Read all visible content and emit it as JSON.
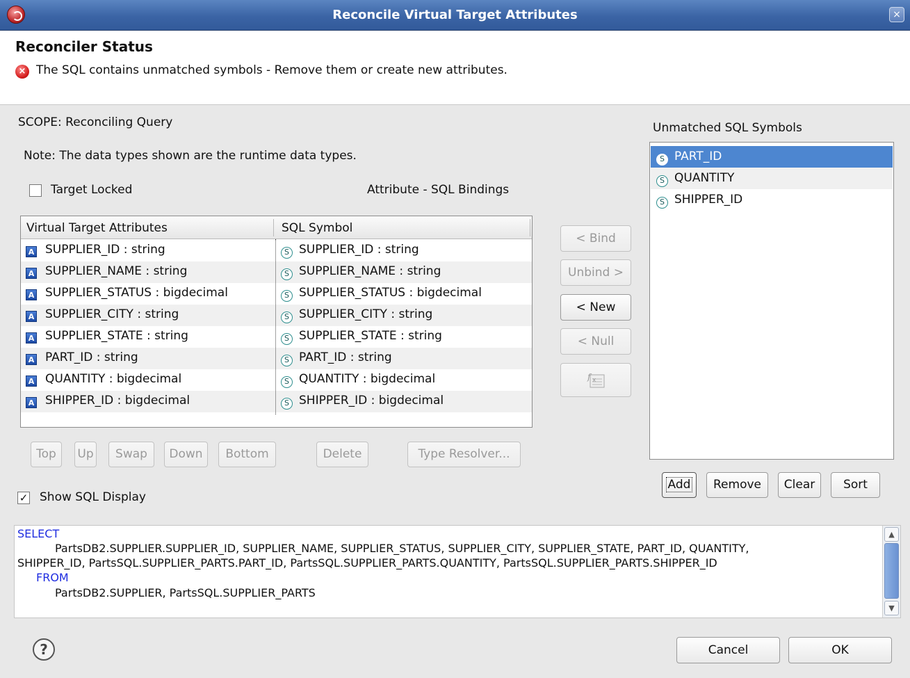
{
  "window": {
    "title": "Reconcile Virtual Target Attributes",
    "close_glyph": "×"
  },
  "status": {
    "title": "Reconciler Status",
    "message": "The SQL contains unmatched symbols - Remove them or create new attributes.",
    "error_glyph": "×"
  },
  "scope_label": "SCOPE: Reconciling Query",
  "note": "Note: The data types shown are the runtime data types.",
  "target_locked": {
    "label": "Target Locked",
    "checked": false
  },
  "bindings_label": "Attribute - SQL Bindings",
  "table": {
    "headers": [
      "Virtual Target Attributes",
      "SQL Symbol"
    ],
    "rows": [
      {
        "attribute": "SUPPLIER_ID : string",
        "symbol": "SUPPLIER_ID : string"
      },
      {
        "attribute": "SUPPLIER_NAME : string",
        "symbol": "SUPPLIER_NAME : string"
      },
      {
        "attribute": "SUPPLIER_STATUS : bigdecimal",
        "symbol": "SUPPLIER_STATUS : bigdecimal"
      },
      {
        "attribute": "SUPPLIER_CITY : string",
        "symbol": "SUPPLIER_CITY : string"
      },
      {
        "attribute": "SUPPLIER_STATE : string",
        "symbol": "SUPPLIER_STATE : string"
      },
      {
        "attribute": "PART_ID : string",
        "symbol": "PART_ID : string"
      },
      {
        "attribute": "QUANTITY : bigdecimal",
        "symbol": "QUANTITY : bigdecimal"
      },
      {
        "attribute": "SHIPPER_ID : bigdecimal",
        "symbol": "SHIPPER_ID : bigdecimal"
      }
    ]
  },
  "icons": {
    "attribute": "A",
    "symbol": "S"
  },
  "middle_buttons": {
    "bind": "< Bind",
    "unbind": "Unbind >",
    "new": "< New",
    "null": "< Null"
  },
  "order_buttons": {
    "top": "Top",
    "up": "Up",
    "swap": "Swap",
    "down": "Down",
    "bottom": "Bottom",
    "delete": "Delete",
    "type_resolver": "Type Resolver..."
  },
  "show_sql": {
    "label": "Show SQL Display",
    "checked": true,
    "check_glyph": "✓"
  },
  "unmatched": {
    "label": "Unmatched SQL Symbols",
    "items": [
      "PART_ID",
      "QUANTITY",
      "SHIPPER_ID"
    ],
    "selected_index": 0,
    "buttons": {
      "add": "Add",
      "remove": "Remove",
      "clear": "Clear",
      "sort": "Sort"
    }
  },
  "sql": {
    "select_kw": "SELECT",
    "line1": "PartsDB2.SUPPLIER.SUPPLIER_ID, SUPPLIER_NAME, SUPPLIER_STATUS, SUPPLIER_CITY, SUPPLIER_STATE, PART_ID, QUANTITY,",
    "line2": "SHIPPER_ID, PartsSQL.SUPPLIER_PARTS.PART_ID, PartsSQL.SUPPLIER_PARTS.QUANTITY, PartsSQL.SUPPLIER_PARTS.SHIPPER_ID",
    "from_kw": "FROM",
    "line3": "PartsDB2.SUPPLIER, PartsSQL.SUPPLIER_PARTS"
  },
  "help_glyph": "?",
  "footer": {
    "cancel": "Cancel",
    "ok": "OK"
  },
  "colors": {
    "titlebar": "#3b64a5",
    "selection": "#4d86d0",
    "sql_keyword": "#1f2de0"
  }
}
